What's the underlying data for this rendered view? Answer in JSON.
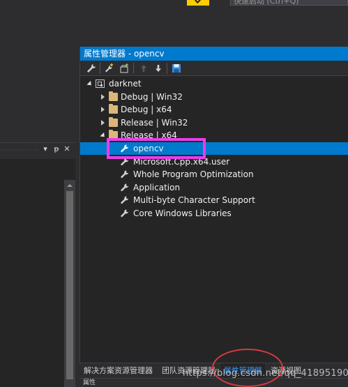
{
  "top": {
    "search_placeholder": "快速启动 (Ctrl+Q)"
  },
  "left_panel": {
    "pin_glyph": "▾",
    "dock_glyph": "ᵽ",
    "close_glyph": "✕"
  },
  "property_manager": {
    "title": "属性管理器 - opencv",
    "toolbar": [
      "properties-icon",
      "add-new-property-sheet-icon",
      "add-existing-property-sheet-icon",
      "move-up-icon",
      "move-down-icon",
      "save-icon"
    ],
    "tree": {
      "root": "darknet",
      "configs": [
        {
          "label": "Debug | Win32",
          "expanded": false
        },
        {
          "label": "Debug | x64",
          "expanded": false
        },
        {
          "label": "Release | Win32",
          "expanded": false
        },
        {
          "label": "Release | x64",
          "expanded": true
        }
      ],
      "sheets": [
        "opencv",
        "Microsoft.Cpp.x64.user",
        "Whole Program Optimization",
        "Application",
        "Multi-byte Character Support",
        "Core Windows Libraries"
      ],
      "selected": "opencv"
    }
  },
  "bottom_tabs": [
    {
      "label": "解决方案资源管理器",
      "active": false
    },
    {
      "label": "团队资源管理器",
      "active": false
    },
    {
      "label": "属性管理器",
      "active": true
    },
    {
      "label": "资源视图",
      "active": false
    }
  ],
  "status": {
    "text": "属性"
  },
  "watermark": "https://blog.csdn.net/qq_41895190",
  "colors": {
    "accent": "#007acc",
    "highlight_box": "#ea3cea",
    "annotation_circle": "#d23b3b",
    "background": "#2d2d30"
  }
}
